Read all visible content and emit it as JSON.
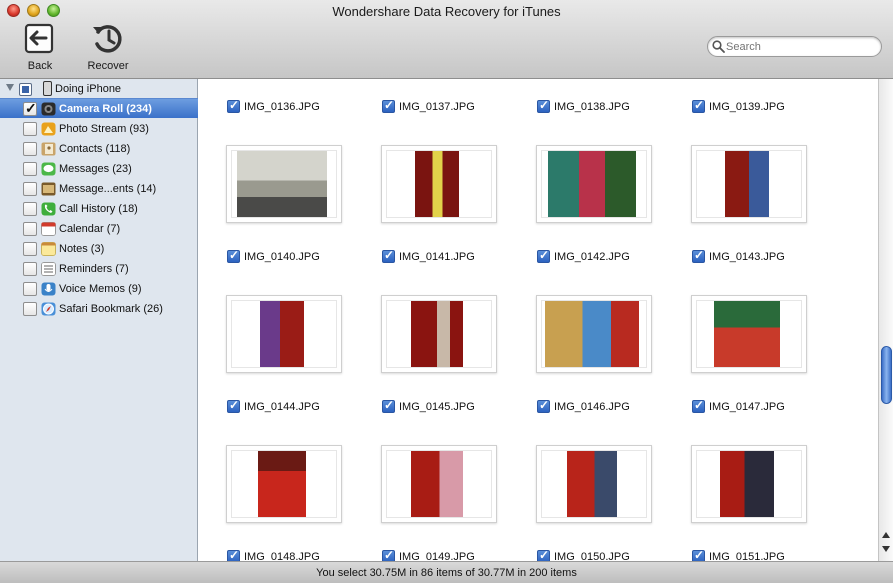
{
  "window": {
    "title": "Wondershare Data Recovery for iTunes"
  },
  "toolbar": {
    "back_label": "Back",
    "recover_label": "Recover"
  },
  "search": {
    "placeholder": "Search",
    "value": ""
  },
  "sidebar": {
    "device_label": "Doing iPhone",
    "items": [
      {
        "label": "Camera Roll (234)",
        "icon": "camera-icon",
        "selected": true,
        "checked": true
      },
      {
        "label": "Photo Stream (93)",
        "icon": "photo-stream-icon",
        "selected": false,
        "checked": false
      },
      {
        "label": "Contacts (118)",
        "icon": "contacts-icon",
        "selected": false,
        "checked": false
      },
      {
        "label": "Messages (23)",
        "icon": "messages-icon",
        "selected": false,
        "checked": false
      },
      {
        "label": "Message...ents (14)",
        "icon": "message-attachments-icon",
        "selected": false,
        "checked": false
      },
      {
        "label": "Call History (18)",
        "icon": "phone-icon",
        "selected": false,
        "checked": false
      },
      {
        "label": "Calendar (7)",
        "icon": "calendar-icon",
        "selected": false,
        "checked": false
      },
      {
        "label": "Notes (3)",
        "icon": "notes-icon",
        "selected": false,
        "checked": false
      },
      {
        "label": "Reminders (7)",
        "icon": "reminders-icon",
        "selected": false,
        "checked": false
      },
      {
        "label": "Voice Memos (9)",
        "icon": "microphone-icon",
        "selected": false,
        "checked": false
      },
      {
        "label": "Safari Bookmark (26)",
        "icon": "safari-icon",
        "selected": false,
        "checked": false
      }
    ]
  },
  "files": [
    {
      "name": "IMG_0136.JPG",
      "checked": true
    },
    {
      "name": "IMG_0137.JPG",
      "checked": true
    },
    {
      "name": "IMG_0138.JPG",
      "checked": true
    },
    {
      "name": "IMG_0139.JPG",
      "checked": true
    },
    {
      "name": "IMG_0140.JPG",
      "checked": true
    },
    {
      "name": "IMG_0141.JPG",
      "checked": true
    },
    {
      "name": "IMG_0142.JPG",
      "checked": true
    },
    {
      "name": "IMG_0143.JPG",
      "checked": true
    },
    {
      "name": "IMG_0144.JPG",
      "checked": true
    },
    {
      "name": "IMG_0145.JPG",
      "checked": true
    },
    {
      "name": "IMG_0146.JPG",
      "checked": true
    },
    {
      "name": "IMG_0147.JPG",
      "checked": true
    },
    {
      "name": "IMG_0148.JPG",
      "checked": true
    },
    {
      "name": "IMG_0149.JPG",
      "checked": true
    },
    {
      "name": "IMG_0150.JPG",
      "checked": true
    },
    {
      "name": "IMG_0151.JPG",
      "checked": true
    }
  ],
  "status": {
    "text": "You select 30.75M in 86 items of 30.77M in 200 items"
  }
}
